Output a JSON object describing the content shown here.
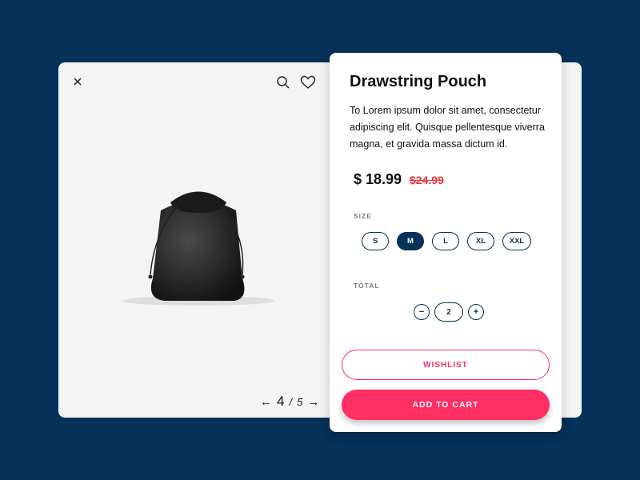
{
  "gallery": {
    "icons": {
      "close": "close-icon",
      "search": "search-icon",
      "favorite": "heart-icon"
    },
    "pager": {
      "prev": "←",
      "current": "4",
      "separator": "/",
      "total": "5",
      "next": "→"
    }
  },
  "product": {
    "title": "Drawstring Pouch",
    "description": "To Lorem ipsum dolor sit amet, consectetur adipiscing elit. Quisque pellentesque viverra magna, et gravida massa dictum id.",
    "price": "$ 18.99",
    "old_price": "$24.99",
    "size_label": "SIZE",
    "sizes": [
      "S",
      "M",
      "L",
      "XL",
      "XXL"
    ],
    "selected_size": "M",
    "total_label": "TOTAL",
    "quantity": {
      "minus": "−",
      "value": "2",
      "plus": "+"
    },
    "wishlist_label": "WISHLIST",
    "cart_label": "ADD TO CART"
  },
  "colors": {
    "background": "#063158",
    "accent": "#ff2e63",
    "sale": "#e8343b"
  }
}
